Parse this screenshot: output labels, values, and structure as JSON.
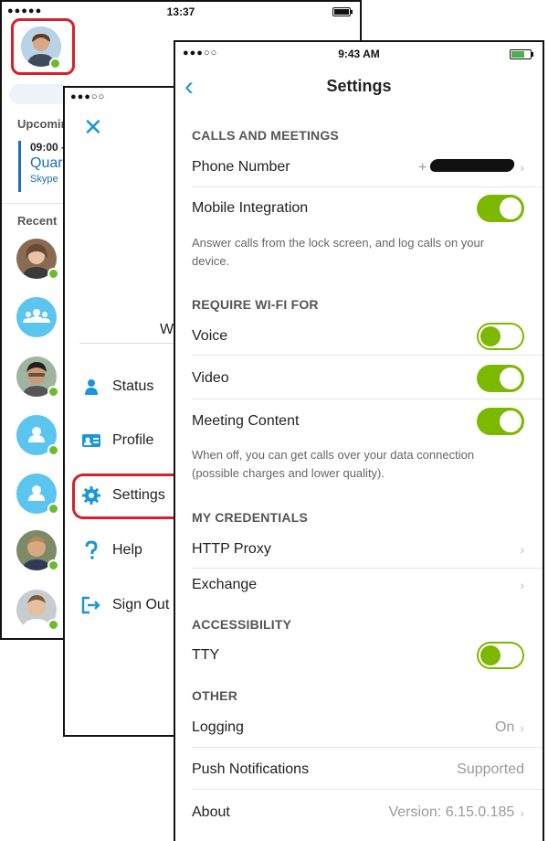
{
  "phone_left": {
    "status_time": "13:37",
    "status_signal": "●●●●●",
    "upcoming_label": "Upcomin",
    "meeting": {
      "time": "09:00 -",
      "title": "Quar",
      "subtitle": "Skype"
    },
    "recent_label": "Recent"
  },
  "phone_menu": {
    "status_signal": "●●●○○",
    "close_glyph": "✕",
    "greeting_fragment": "W",
    "items": [
      {
        "label": "Status",
        "icon": "person-icon"
      },
      {
        "label": "Profile",
        "icon": "id-card-icon"
      },
      {
        "label": "Settings",
        "icon": "gear-icon"
      },
      {
        "label": "Help",
        "icon": "question-icon"
      },
      {
        "label": "Sign Out",
        "icon": "sign-out-icon"
      }
    ]
  },
  "settings": {
    "status_time": "9:43 AM",
    "status_signal": "●●●○○",
    "title": "Settings",
    "back_glyph": "‹",
    "sections": {
      "calls": {
        "header": "CALLS AND MEETINGS",
        "phone_number_label": "Phone Number",
        "phone_number_prefix": "+",
        "mobile_integration_label": "Mobile Integration",
        "mobile_integration_on": true,
        "note": "Answer calls from the lock screen, and log calls on your device."
      },
      "wifi": {
        "header": "REQUIRE WI-FI FOR",
        "voice_label": "Voice",
        "voice_on": false,
        "video_label": "Video",
        "video_on": true,
        "meeting_content_label": "Meeting Content",
        "meeting_content_on": true,
        "note": "When off, you can get calls over your data connection (possible charges and lower quality)."
      },
      "credentials": {
        "header": "MY CREDENTIALS",
        "http_proxy_label": "HTTP Proxy",
        "exchange_label": "Exchange"
      },
      "accessibility": {
        "header": "ACCESSIBILITY",
        "tty_label": "TTY",
        "tty_on": false
      },
      "other": {
        "header": "OTHER",
        "logging_label": "Logging",
        "logging_value": "On",
        "push_label": "Push Notifications",
        "push_value": "Supported",
        "about_label": "About",
        "about_value": "Version: 6.15.0.185"
      }
    },
    "colors": {
      "accent": "#1a97d8",
      "toggle_green": "#7cb800",
      "highlight_red": "#d81f2a",
      "presence_green": "#6cbb2a"
    }
  }
}
